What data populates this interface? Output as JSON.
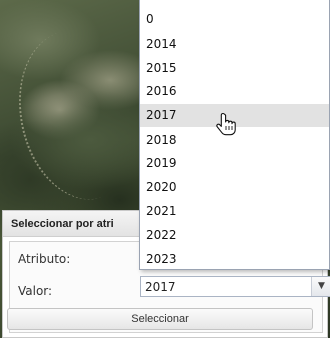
{
  "panel": {
    "title": "Seleccionar por atri",
    "attribute_label": "Atributo:",
    "value_label": "Valor:",
    "value_selected": "2017",
    "select_button": "Seleccionar"
  },
  "dropdown": {
    "options": [
      "0",
      "2014",
      "2015",
      "2016",
      "2017",
      "2018",
      "2019",
      "2020",
      "2021",
      "2022",
      "2023"
    ],
    "hovered": "2017"
  },
  "icons": {
    "select_trigger": "chevron-down-icon",
    "cursor": "hand-pointer-icon"
  }
}
